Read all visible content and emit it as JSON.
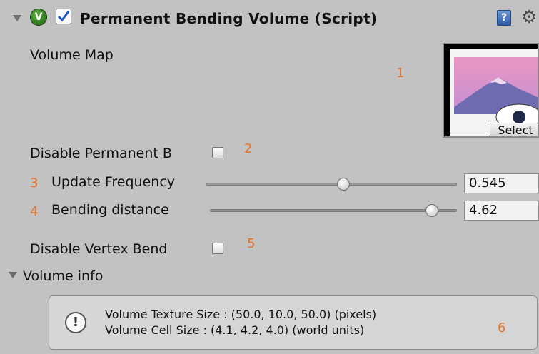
{
  "component": {
    "title": "Permanent Bending Volume (Script)",
    "enabled": true,
    "icon_v": "V",
    "help_icon": "help-book-icon",
    "settings_icon": "gear-icon"
  },
  "volume_map": {
    "label": "Volume Map",
    "select_label": "Select",
    "annotation": "1"
  },
  "disable_permanent": {
    "label": "Disable Permanent B",
    "checked": false,
    "annotation": "2"
  },
  "update_frequency": {
    "label": "Update Frequency",
    "value": "0.545",
    "slider_fraction": 0.545,
    "annotation": "3"
  },
  "bending_distance": {
    "label": "Bending distance",
    "value": "4.62",
    "annotation": "4"
  },
  "disable_vertex_bend": {
    "label": "Disable Vertex Bend",
    "checked": false,
    "annotation": "5"
  },
  "volume_info": {
    "label": "Volume info",
    "line1": "Volume Texture Size : (50.0, 10.0, 50.0) (pixels)",
    "line2": "Volume Cell Size : (4.1, 4.2, 4.0) (world units)",
    "annotation": "6"
  },
  "colors": {
    "background": "#c2c2c2",
    "annotation": "#e8702a",
    "v_badge": "#2f7d1f"
  }
}
